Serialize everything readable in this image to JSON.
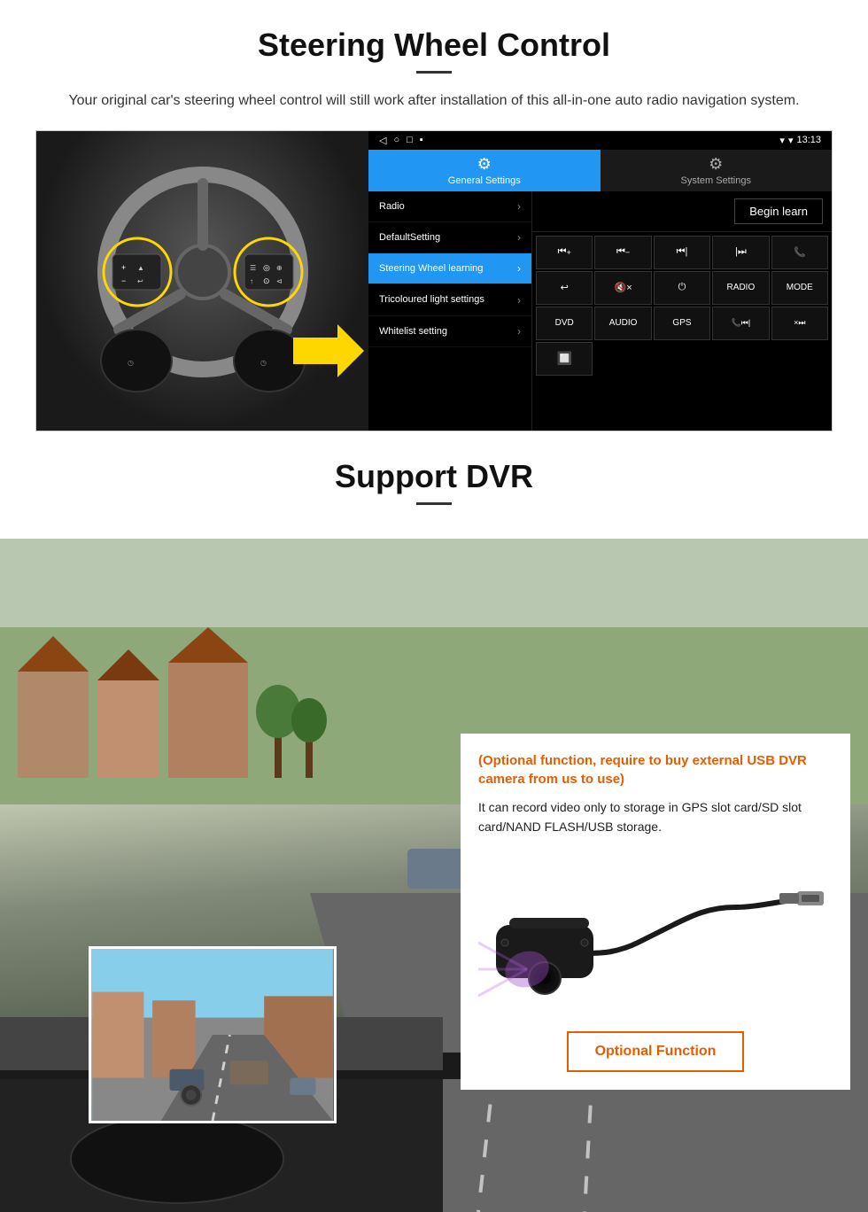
{
  "steering": {
    "title": "Steering Wheel Control",
    "description": "Your original car's steering wheel control will still work after installation of this all-in-one auto radio navigation system.",
    "statusbar": {
      "time": "13:13",
      "signal": "▼",
      "wifi": "▾"
    },
    "tabs": {
      "general": "General Settings",
      "system": "System Settings"
    },
    "menu_items": [
      {
        "label": "Radio",
        "active": false
      },
      {
        "label": "DefaultSetting",
        "active": false
      },
      {
        "label": "Steering Wheel learning",
        "active": true
      },
      {
        "label": "Tricoloured light settings",
        "active": false
      },
      {
        "label": "Whitelist setting",
        "active": false
      }
    ],
    "begin_learn": "Begin learn",
    "control_buttons": [
      "⏮+",
      "⏮−",
      "⏮|",
      "|⏭",
      "📞",
      "↩",
      "🔇×",
      "⏻",
      "RADIO",
      "MODE",
      "DVD",
      "AUDIO",
      "GPS",
      "📞⏮|",
      "×⏭"
    ]
  },
  "dvr": {
    "title": "Support DVR",
    "optional_text": "(Optional function, require to buy external USB DVR camera from us to use)",
    "description": "It can record video only to storage in GPS slot card/SD slot card/NAND FLASH/USB storage.",
    "optional_button_label": "Optional Function"
  }
}
